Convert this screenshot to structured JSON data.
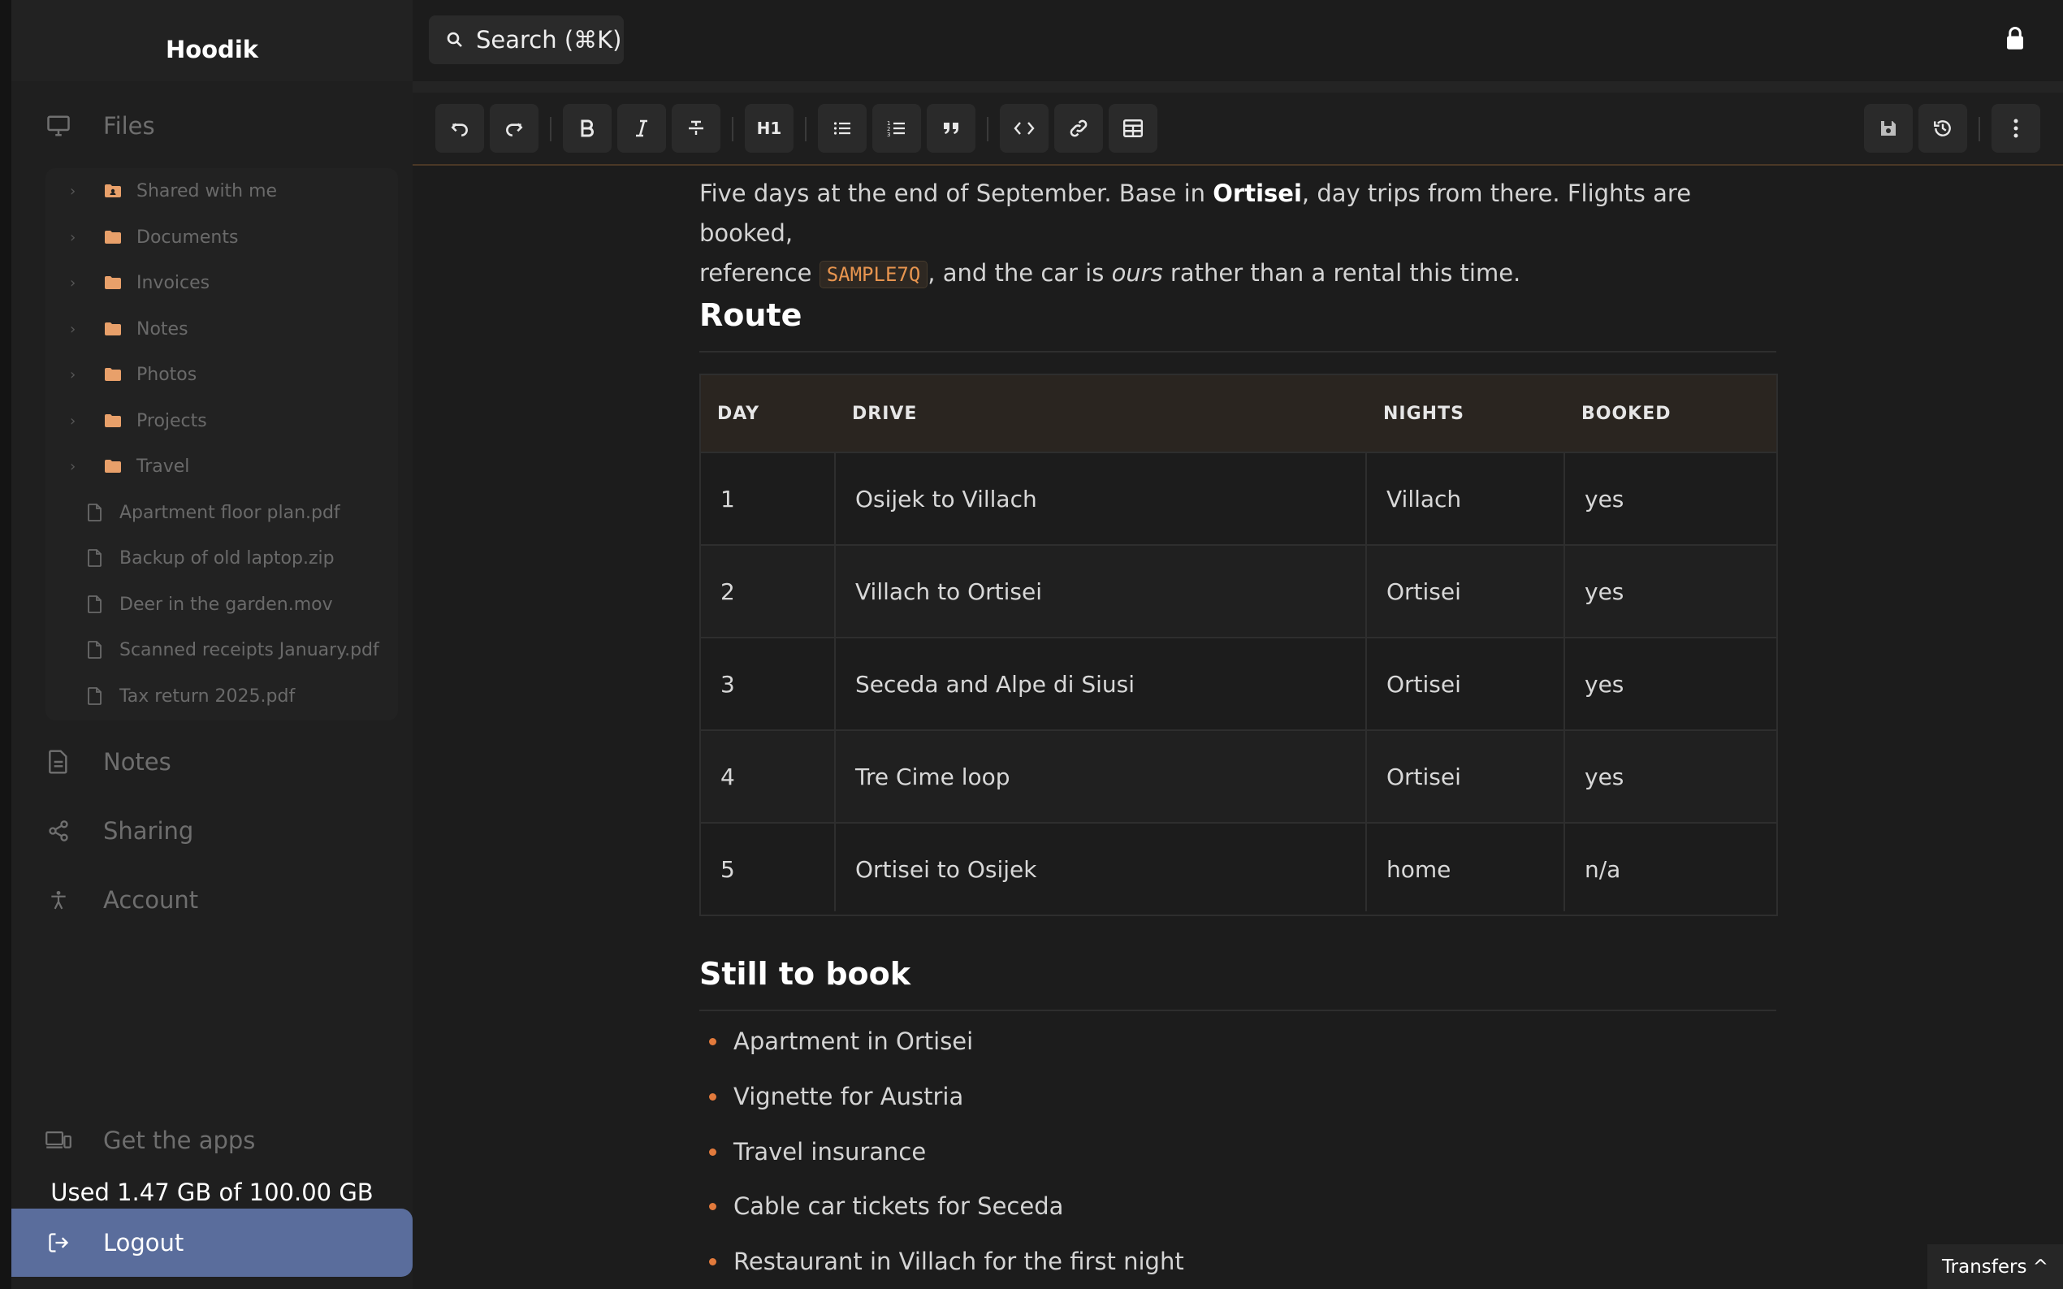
{
  "app": {
    "title": "Hoodik"
  },
  "nav": {
    "files": "Files",
    "notes": "Notes",
    "sharing": "Sharing",
    "account": "Account",
    "get_apps": "Get the apps",
    "logout": "Logout"
  },
  "tree": {
    "folders": [
      "Shared with me",
      "Documents",
      "Invoices",
      "Notes",
      "Photos",
      "Projects",
      "Travel"
    ],
    "files": [
      "Apartment floor plan.pdf",
      "Backup of old laptop.zip",
      "Deer in the garden.mov",
      "Scanned receipts January.pdf",
      "Tax return 2025.pdf"
    ]
  },
  "storage": {
    "text": "Used 1.47 GB of 100.00 GB"
  },
  "search": {
    "label": "Search (⌘K)"
  },
  "toolbar": {
    "h1": "H1"
  },
  "doc": {
    "intro_1": "Five days at the end of September. Base in ",
    "intro_bold": "Ortisei",
    "intro_2": ", day trips from there. Flights are booked,",
    "intro_3": "reference ",
    "intro_code": "SAMPLE7Q",
    "intro_4": ", and the car is ",
    "intro_em": "ours",
    "intro_5": " rather than a rental this time.",
    "route_heading": "Route",
    "table": {
      "headers": [
        "DAY",
        "DRIVE",
        "NIGHTS",
        "BOOKED"
      ],
      "rows": [
        [
          "1",
          "Osijek to Villach",
          "Villach",
          "yes"
        ],
        [
          "2",
          "Villach to Ortisei",
          "Ortisei",
          "yes"
        ],
        [
          "3",
          "Seceda and Alpe di Siusi",
          "Ortisei",
          "yes"
        ],
        [
          "4",
          "Tre Cime loop",
          "Ortisei",
          "yes"
        ],
        [
          "5",
          "Ortisei to Osijek",
          "home",
          "n/a"
        ]
      ]
    },
    "book_heading": "Still to book",
    "todo": [
      "Apartment in Ortisei",
      "Vignette for Austria",
      "Travel insurance",
      "Cable car tickets for Seceda",
      "Restaurant in Villach for the first night"
    ]
  },
  "transfers": {
    "label": "Transfers ^"
  },
  "colors": {
    "accent": "#e27a3c",
    "logout_bg": "#5a6d9c",
    "folder": "#e8a06a"
  }
}
